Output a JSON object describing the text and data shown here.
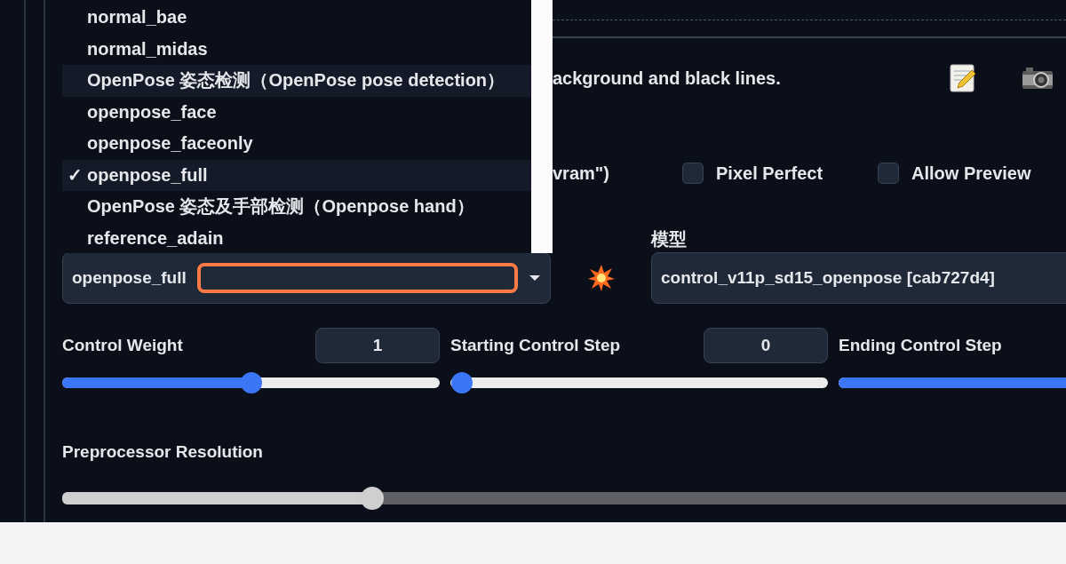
{
  "dropdown": {
    "items": [
      {
        "label": "normal_bae",
        "selected": false,
        "highlighted": false
      },
      {
        "label": "normal_midas",
        "selected": false,
        "highlighted": false
      },
      {
        "label": "OpenPose 姿态检测（OpenPose pose detection）",
        "selected": false,
        "highlighted": true
      },
      {
        "label": "openpose_face",
        "selected": false,
        "highlighted": false
      },
      {
        "label": "openpose_faceonly",
        "selected": false,
        "highlighted": false
      },
      {
        "label": "openpose_full",
        "selected": true,
        "highlighted": false
      },
      {
        "label": "OpenPose 姿态及手部检测（Openpose hand）",
        "selected": false,
        "highlighted": false
      },
      {
        "label": "reference_adain",
        "selected": false,
        "highlighted": false
      }
    ],
    "check_mark": "✓"
  },
  "description": "ackground and black lines.",
  "low_vram_label": "vram\")",
  "checkboxes": [
    {
      "label": "Pixel Perfect",
      "checked": false
    },
    {
      "label": "Allow Preview",
      "checked": false
    }
  ],
  "model_label": "模型",
  "preprocessor": {
    "value": "openpose_full"
  },
  "model": {
    "value": "control_v11p_sd15_openpose [cab727d4]"
  },
  "sliders": [
    {
      "label": "Control Weight",
      "value": "1",
      "level": 0.5,
      "kind": "accent"
    },
    {
      "label": "Starting Control Step",
      "value": "0",
      "level": 0,
      "kind": "accent"
    },
    {
      "label": "Ending Control Step",
      "level": 1,
      "kind": "accent"
    },
    {
      "label": "Preprocessor Resolution",
      "level": 0.264,
      "kind": "plain"
    }
  ]
}
